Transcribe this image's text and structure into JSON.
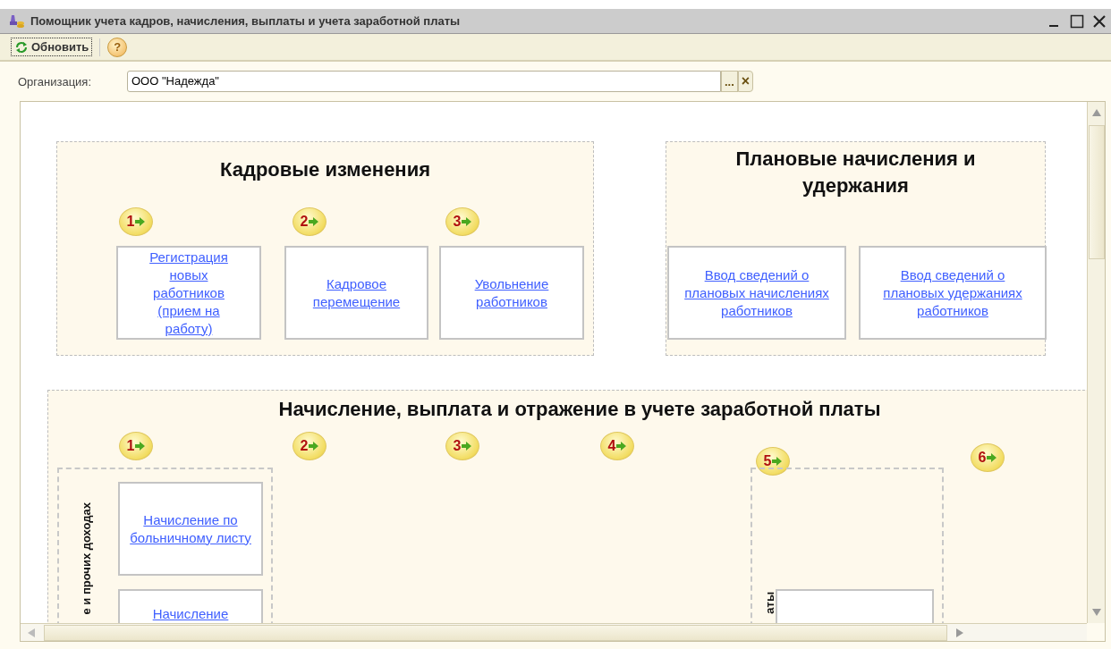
{
  "window": {
    "title": "Помощник учета кадров, начисления, выплаты и учета заработной платы"
  },
  "toolbar": {
    "refresh_label": "Обновить",
    "help_label": "?"
  },
  "organization": {
    "label": "Организация:",
    "value": "ООО \"Надежда\"",
    "select_label": "...",
    "clear_label": "×"
  },
  "sections": [
    {
      "title": "Кадровые изменения",
      "steps": [
        "1",
        "2",
        "3"
      ],
      "cards": [
        {
          "kind": "link",
          "text": "Регистрация новых работников (прием на работу)"
        },
        {
          "kind": "link",
          "text": "Кадровое перемещение"
        },
        {
          "kind": "link",
          "text": "Увольнение работников"
        }
      ]
    },
    {
      "title": "Плановые начисления и удержания",
      "cards": [
        {
          "kind": "link",
          "text": "Ввод сведений о плановых начислениях работников"
        },
        {
          "kind": "link",
          "text": "Ввод сведений о плановых удержаниях работников"
        }
      ]
    },
    {
      "title": "Начисление, выплата и отражение в учете заработной платы",
      "steps": [
        "1",
        "2",
        "3",
        "4",
        "5",
        "6"
      ],
      "groups": [
        {
          "caption": "е и прочих доходах",
          "cards": [
            {
              "kind": "link",
              "text": "Начисление по больничному листу"
            },
            {
              "kind": "link",
              "text": "Начисление"
            }
          ]
        },
        {
          "caption": "аты",
          "cards": [
            {
              "kind": "blank"
            }
          ]
        }
      ]
    }
  ]
}
